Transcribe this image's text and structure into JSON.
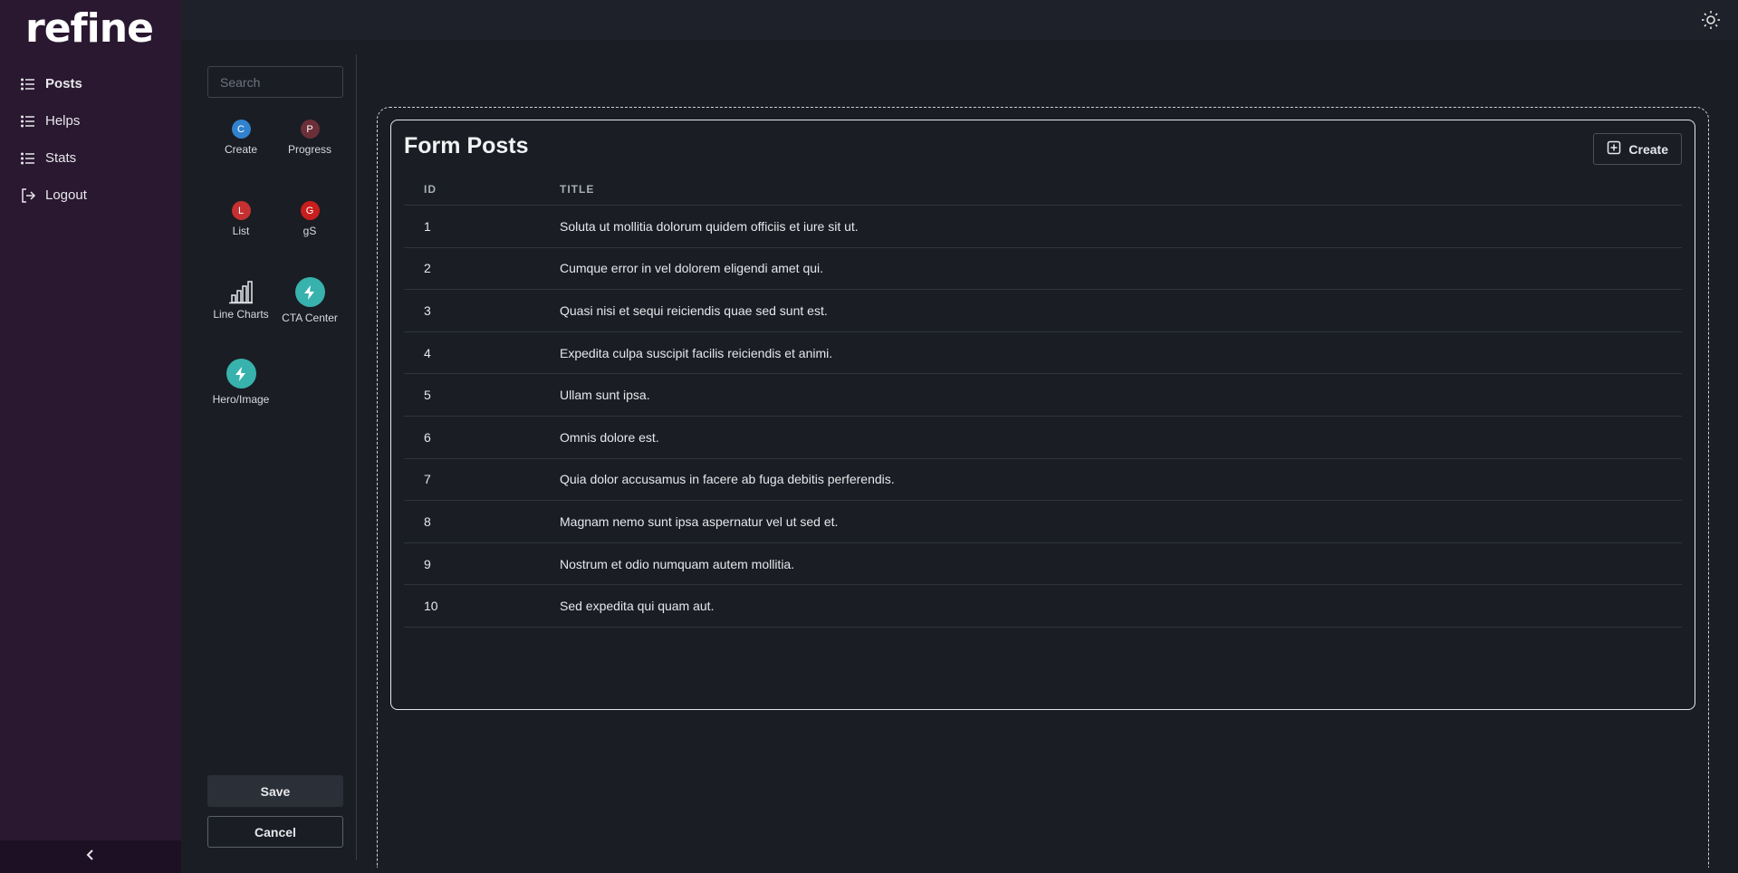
{
  "logo": "refine",
  "nav": [
    {
      "label": "Posts",
      "icon": "list-icon",
      "active": true
    },
    {
      "label": "Helps",
      "icon": "list-icon"
    },
    {
      "label": "Stats",
      "icon": "list-icon"
    },
    {
      "label": "Logout",
      "icon": "logout-icon"
    }
  ],
  "builder": {
    "search_placeholder": "Search",
    "blocks": [
      {
        "badge": "C",
        "label": "Create",
        "color": "#3182ce"
      },
      {
        "badge": "P",
        "label": "Progress",
        "color": "#6b2f3a"
      },
      {
        "badge": "L",
        "label": "List",
        "color": "#c53030"
      },
      {
        "badge": "G",
        "label": "gS",
        "color": "#c81e1e"
      },
      {
        "label": "Line Charts",
        "icon": "bar-chart-icon"
      },
      {
        "label": "CTA Center",
        "icon": "lightning-icon",
        "color": "#38b2ac"
      },
      {
        "label": "Hero/Image",
        "icon": "lightning-icon",
        "color": "#38b2ac"
      }
    ],
    "save_label": "Save",
    "cancel_label": "Cancel"
  },
  "card": {
    "title": "Form Posts",
    "create_label": "Create",
    "columns": [
      "ID",
      "TITLE"
    ],
    "rows": [
      {
        "id": "1",
        "title": "Soluta ut mollitia dolorum quidem officiis et iure sit ut."
      },
      {
        "id": "2",
        "title": "Cumque error in vel dolorem eligendi amet qui."
      },
      {
        "id": "3",
        "title": "Quasi nisi et sequi reiciendis quae sed sunt est."
      },
      {
        "id": "4",
        "title": "Expedita culpa suscipit facilis reiciendis et animi."
      },
      {
        "id": "5",
        "title": "Ullam sunt ipsa."
      },
      {
        "id": "6",
        "title": "Omnis dolore est."
      },
      {
        "id": "7",
        "title": "Quia dolor accusamus in facere ab fuga debitis perferendis."
      },
      {
        "id": "8",
        "title": "Magnam nemo sunt ipsa aspernatur vel ut sed et."
      },
      {
        "id": "9",
        "title": "Nostrum et odio numquam autem mollitia."
      },
      {
        "id": "10",
        "title": "Sed expedita qui quam aut."
      }
    ]
  },
  "colors": {
    "sidebar_bg": "#2a1730",
    "page_bg": "#1a1d23",
    "accent_teal": "#38b2ac"
  }
}
